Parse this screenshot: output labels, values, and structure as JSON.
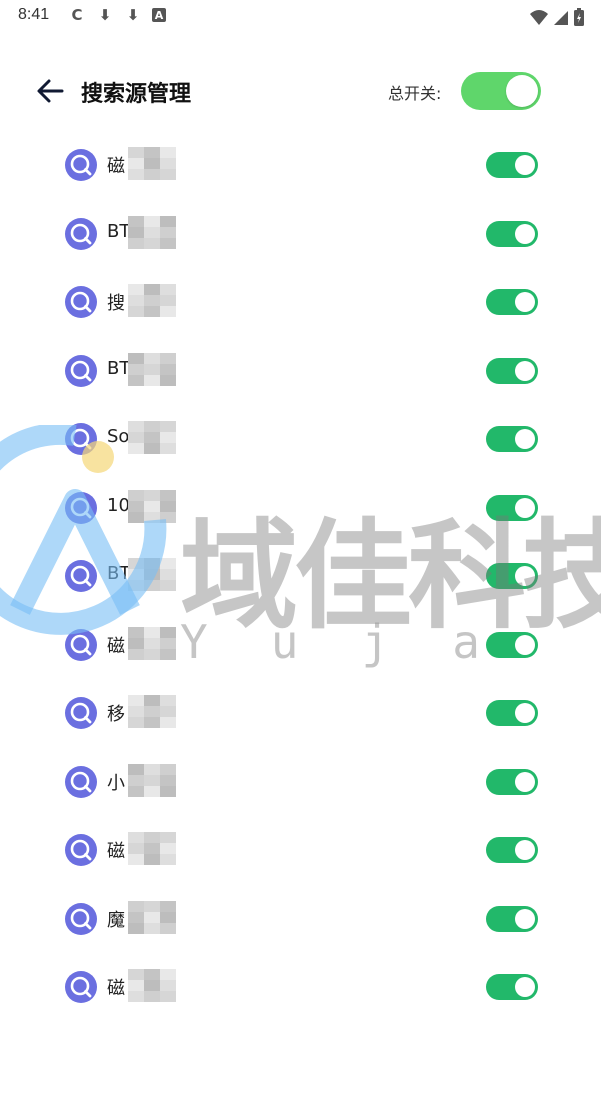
{
  "status_bar": {
    "time": "8:41",
    "left_icons": [
      "sync-icon",
      "download-icon",
      "download-icon",
      "app-a-icon"
    ],
    "left_glyphs": [
      "C",
      "⬇",
      "⬇",
      "A"
    ]
  },
  "header": {
    "title": "搜索源管理",
    "master_label": "总开关:",
    "master_switch_on": true
  },
  "sources": [
    {
      "name_visible": "磁",
      "switch_on": true
    },
    {
      "name_visible": "BT",
      "switch_on": true
    },
    {
      "name_visible": "搜",
      "switch_on": true
    },
    {
      "name_visible": "BT",
      "switch_on": true
    },
    {
      "name_visible": "So",
      "switch_on": true
    },
    {
      "name_visible": "10",
      "switch_on": true
    },
    {
      "name_visible": "BT",
      "switch_on": true
    },
    {
      "name_visible": "磁",
      "switch_on": true
    },
    {
      "name_visible": "移",
      "switch_on": true
    },
    {
      "name_visible": "小",
      "switch_on": true
    },
    {
      "name_visible": "磁",
      "switch_on": true
    },
    {
      "name_visible": "魔",
      "switch_on": true
    },
    {
      "name_visible": "磁",
      "switch_on": true
    }
  ],
  "watermark": {
    "text": "域佳科技",
    "letters": [
      "Y",
      "u",
      "j",
      "a"
    ]
  },
  "colors": {
    "switch_on": "#22b86a",
    "master_switch_on": "#5fd66b",
    "source_icon": "#6b6fe0"
  }
}
